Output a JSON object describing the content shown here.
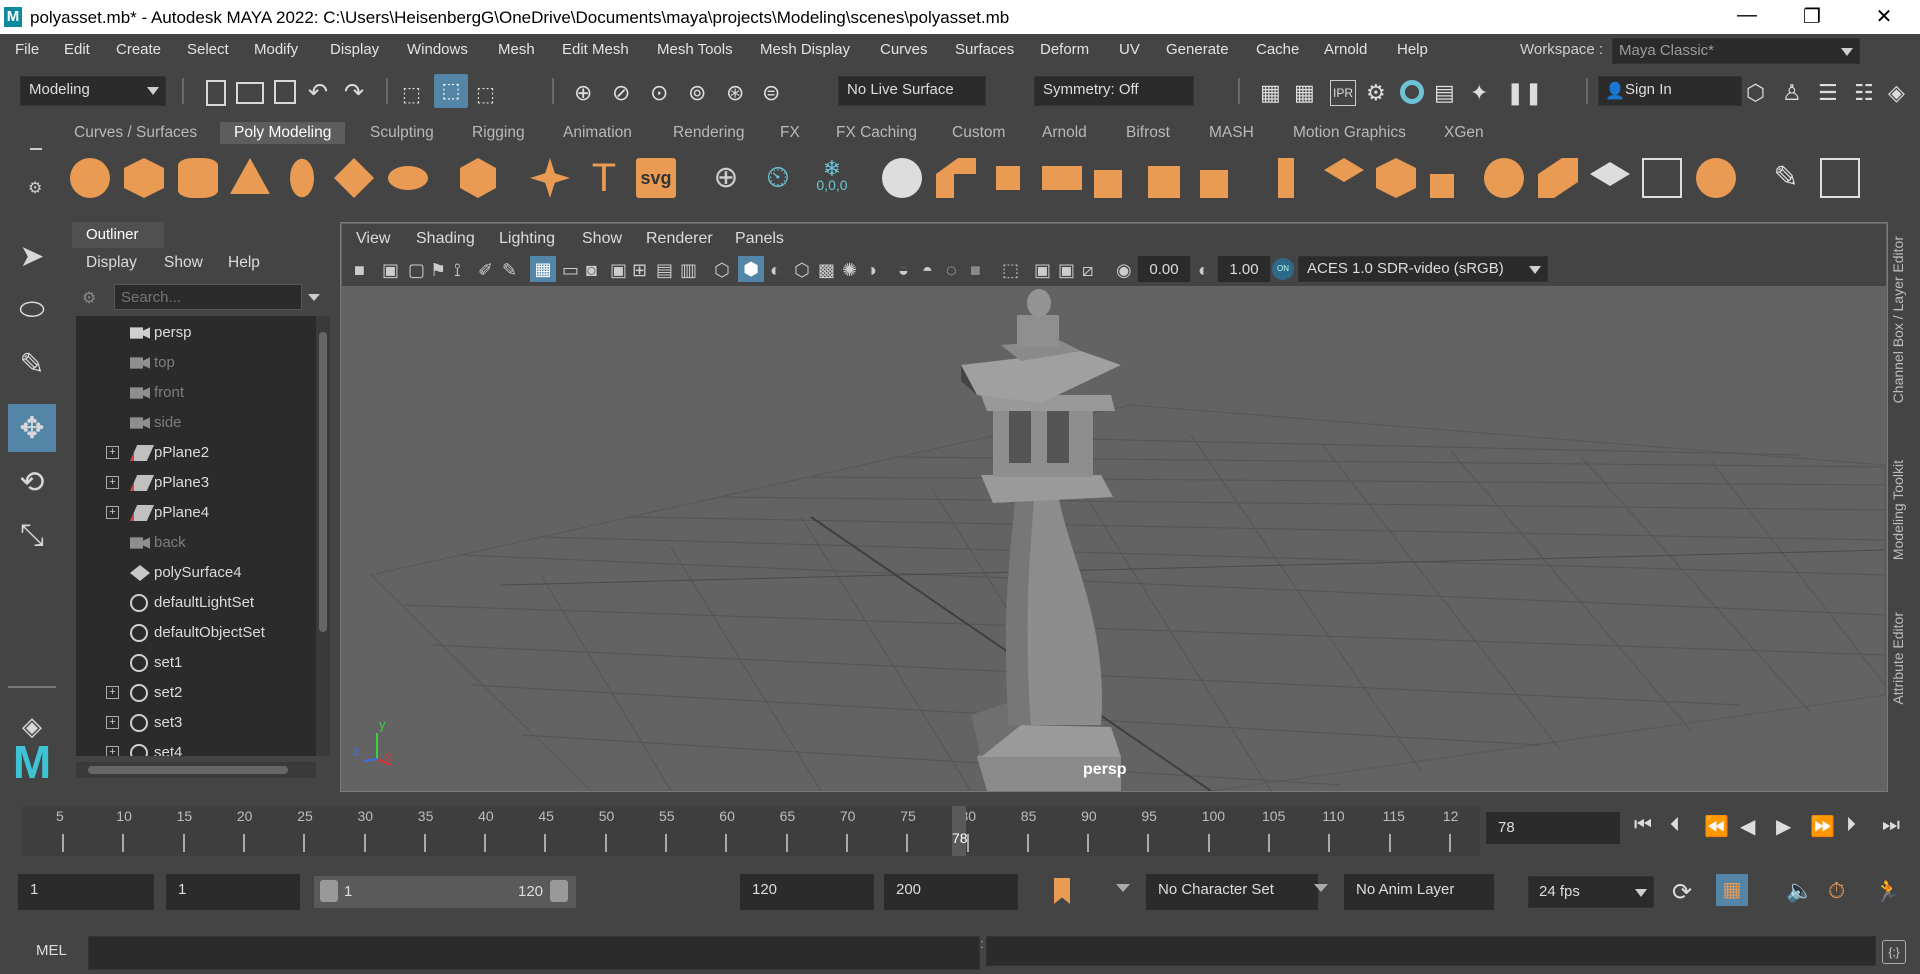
{
  "window": {
    "title": "polyasset.mb* - Autodesk MAYA 2022: C:\\Users\\HeisenbergG\\OneDrive\\Documents\\maya\\projects\\Modeling\\scenes\\polyasset.mb",
    "logo": "M",
    "minimize": "—",
    "restore": "❐",
    "close": "✕"
  },
  "menubar": {
    "items": [
      "File",
      "Edit",
      "Create",
      "Select",
      "Modify",
      "Display",
      "Windows",
      "Mesh",
      "Edit Mesh",
      "Mesh Tools",
      "Mesh Display",
      "Curves",
      "Surfaces",
      "Deform",
      "UV",
      "Generate",
      "Cache",
      "Arnold",
      "Help"
    ],
    "workspace_label": "Workspace :",
    "workspace_value": "Maya Classic*"
  },
  "statusline": {
    "mode": "Modeling",
    "live_surface": "No Live Surface",
    "symmetry": "Symmetry: Off",
    "sign_in": "Sign In"
  },
  "shelf": {
    "tabs": [
      "Curves / Surfaces",
      "Poly Modeling",
      "Sculpting",
      "Rigging",
      "Animation",
      "Rendering",
      "FX",
      "FX Caching",
      "Custom",
      "Arnold",
      "Bifrost",
      "MASH",
      "Motion Graphics",
      "XGen"
    ],
    "active_tab": "Poly Modeling",
    "svg_label": "svg",
    "text_label": "T",
    "coords_label": "0,0,0"
  },
  "outliner": {
    "tab": "Outliner",
    "menu": [
      "Display",
      "Show",
      "Help"
    ],
    "search_placeholder": "Search...",
    "items": [
      {
        "name": "persp",
        "type": "camera",
        "dim": false,
        "expand": false
      },
      {
        "name": "top",
        "type": "camera",
        "dim": true,
        "expand": false
      },
      {
        "name": "front",
        "type": "camera",
        "dim": true,
        "expand": false
      },
      {
        "name": "side",
        "type": "camera",
        "dim": true,
        "expand": false
      },
      {
        "name": "pPlane2",
        "type": "mesh",
        "dim": false,
        "expand": true
      },
      {
        "name": "pPlane3",
        "type": "mesh",
        "dim": false,
        "expand": true
      },
      {
        "name": "pPlane4",
        "type": "mesh",
        "dim": false,
        "expand": true
      },
      {
        "name": "back",
        "type": "camera",
        "dim": true,
        "expand": false
      },
      {
        "name": "polySurface4",
        "type": "poly",
        "dim": false,
        "expand": false
      },
      {
        "name": "defaultLightSet",
        "type": "set",
        "dim": false,
        "expand": false
      },
      {
        "name": "defaultObjectSet",
        "type": "set",
        "dim": false,
        "expand": false
      },
      {
        "name": "set1",
        "type": "set",
        "dim": false,
        "expand": false
      },
      {
        "name": "set2",
        "type": "set",
        "dim": false,
        "expand": true
      },
      {
        "name": "set3",
        "type": "set",
        "dim": false,
        "expand": true
      },
      {
        "name": "set4",
        "type": "set",
        "dim": false,
        "expand": true
      }
    ]
  },
  "viewport": {
    "menu": [
      "View",
      "Shading",
      "Lighting",
      "Show",
      "Renderer",
      "Panels"
    ],
    "exposure": "0.00",
    "gamma": "1.00",
    "color_space": "ACES 1.0 SDR-video (sRGB)",
    "on_label": "ON",
    "camera_label": "persp",
    "axis_x": "x",
    "axis_y": "y",
    "axis_z": "z"
  },
  "right_tabs": [
    "Channel Box / Layer Editor",
    "Modeling Toolkit",
    "Attribute Editor"
  ],
  "timeline": {
    "ticks": [
      "5",
      "10",
      "15",
      "20",
      "25",
      "30",
      "35",
      "40",
      "45",
      "50",
      "55",
      "60",
      "65",
      "70",
      "75",
      "80",
      "85",
      "90",
      "95",
      "100",
      "105",
      "110",
      "115",
      "12"
    ],
    "current_frame_marker": "78",
    "current_frame_field": "78"
  },
  "range": {
    "start": "1",
    "playback_start": "1",
    "range_min": "1",
    "range_max": "120",
    "playback_end": "120",
    "end": "200",
    "character_set": "No Character Set",
    "anim_layer": "No Anim Layer",
    "fps": "24 fps"
  },
  "commandline": {
    "label": "MEL"
  },
  "colors": {
    "accent_orange": "#e99a53",
    "selected_blue": "#5285a6",
    "viewport_bg": "#636363",
    "field_bg": "#2b2b2b"
  }
}
